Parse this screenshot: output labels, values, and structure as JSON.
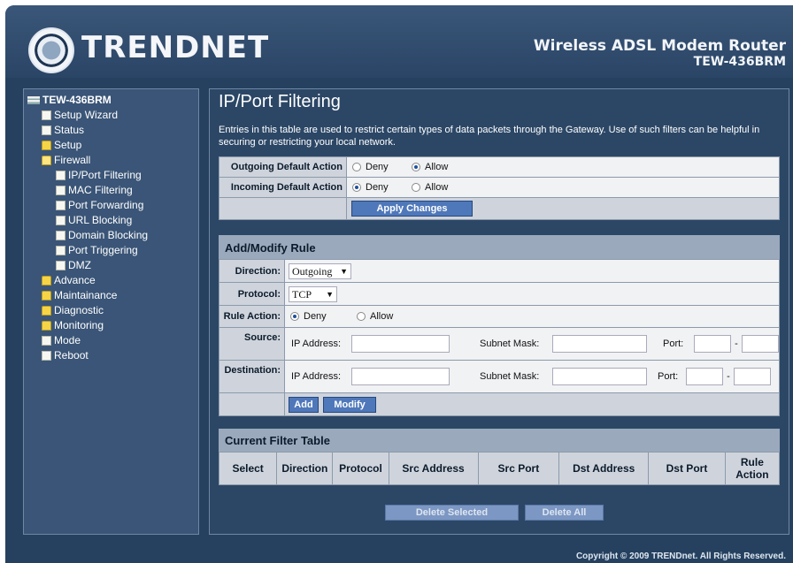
{
  "header": {
    "brand": "TRENDNET",
    "product": "Wireless ADSL Modem Router",
    "model": "TEW-436BRM"
  },
  "sidebar": {
    "root": "TEW-436BRM",
    "items": [
      {
        "label": "Setup Wizard",
        "icon": "page-icon"
      },
      {
        "label": "Status",
        "icon": "page-icon"
      },
      {
        "label": "Setup",
        "icon": "folder-icon"
      },
      {
        "label": "Firewall",
        "icon": "folder-open-icon"
      },
      {
        "label": "IP/Port Filtering",
        "icon": "page-icon"
      },
      {
        "label": "MAC Filtering",
        "icon": "page-icon"
      },
      {
        "label": "Port Forwarding",
        "icon": "page-icon"
      },
      {
        "label": "URL Blocking",
        "icon": "page-icon"
      },
      {
        "label": "Domain Blocking",
        "icon": "page-icon"
      },
      {
        "label": "Port Triggering",
        "icon": "page-icon"
      },
      {
        "label": "DMZ",
        "icon": "page-icon"
      },
      {
        "label": "Advance",
        "icon": "folder-icon"
      },
      {
        "label": "Maintainance",
        "icon": "folder-icon"
      },
      {
        "label": "Diagnostic",
        "icon": "folder-icon"
      },
      {
        "label": "Monitoring",
        "icon": "folder-icon"
      },
      {
        "label": "Mode",
        "icon": "page-icon"
      },
      {
        "label": "Reboot",
        "icon": "page-icon"
      }
    ]
  },
  "main": {
    "title": "IP/Port Filtering",
    "description": "Entries in this table are used to restrict certain types of data packets through the Gateway. Use of such filters can be helpful in securing or restricting your local network.",
    "defaults": {
      "outgoing_label": "Outgoing Default Action",
      "incoming_label": "Incoming Default Action",
      "deny": "Deny",
      "allow": "Allow",
      "outgoing_selected": "Allow",
      "incoming_selected": "Deny",
      "apply_button": "Apply Changes"
    },
    "rule": {
      "section_title": "Add/Modify Rule",
      "direction_label": "Direction:",
      "direction_value": "Outgoing",
      "protocol_label": "Protocol:",
      "protocol_value": "TCP",
      "rule_action_label": "Rule Action:",
      "rule_action_deny": "Deny",
      "rule_action_allow": "Allow",
      "rule_action_selected": "Deny",
      "source_label": "Source:",
      "destination_label": "Destination:",
      "ip_address_label": "IP Address:",
      "subnet_mask_label": "Subnet Mask:",
      "port_label": "Port:",
      "dash": "-",
      "add_button": "Add",
      "modify_button": "Modify"
    },
    "filter_table": {
      "section_title": "Current Filter Table",
      "columns": [
        "Select",
        "Direction",
        "Protocol",
        "Src Address",
        "Src Port",
        "Dst Address",
        "Dst Port",
        "Rule Action"
      ],
      "delete_selected_button": "Delete Selected",
      "delete_all_button": "Delete All"
    }
  },
  "footer": {
    "copyright": "Copyright © 2009 TRENDnet. All Rights Reserved."
  }
}
